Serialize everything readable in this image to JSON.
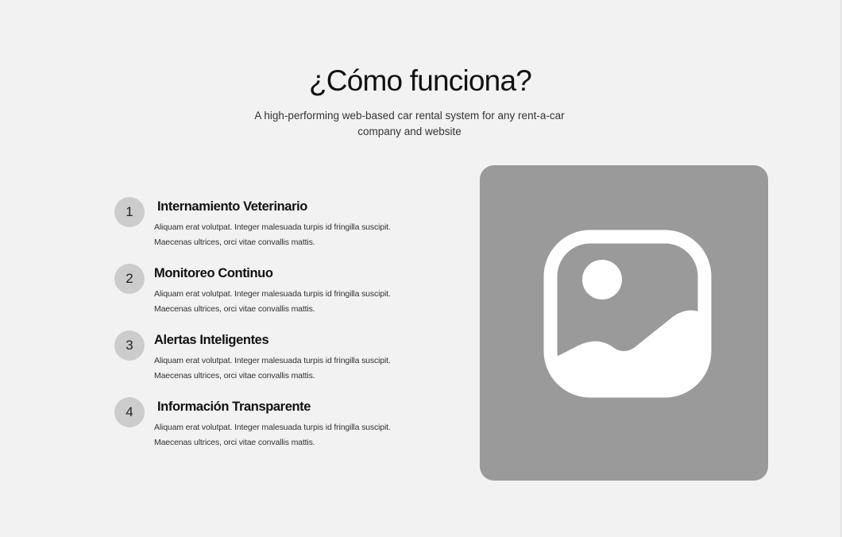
{
  "header": {
    "title": "¿Cómo funciona?",
    "subtitle": "A high-performing web-based car rental system for any rent-a-car company and website"
  },
  "steps": [
    {
      "number": "1",
      "title": "Internamiento Veterinario",
      "text": "Aliquam erat volutpat. Integer malesuada turpis id fringilla suscipit. Maecenas ultrices, orci vitae convallis mattis."
    },
    {
      "number": "2",
      "title": "Monitoreo Continuo",
      "text": "Aliquam erat volutpat. Integer malesuada turpis id fringilla suscipit. Maecenas ultrices, orci vitae convallis mattis."
    },
    {
      "number": "3",
      "title": "Alertas Inteligentes",
      "text": "Aliquam erat volutpat. Integer malesuada turpis id fringilla suscipit. Maecenas ultrices, orci vitae convallis mattis."
    },
    {
      "number": "4",
      "title": "Información Transparente",
      "text": "Aliquam erat volutpat. Integer malesuada turpis id fringilla suscipit. Maecenas ultrices, orci vitae convallis mattis."
    }
  ],
  "media": {
    "icon": "image-placeholder-icon"
  },
  "colors": {
    "background": "#f2f2f2",
    "placeholder": "#9a9a9a",
    "step_circle": "#cccccc",
    "text_primary": "#111111"
  }
}
